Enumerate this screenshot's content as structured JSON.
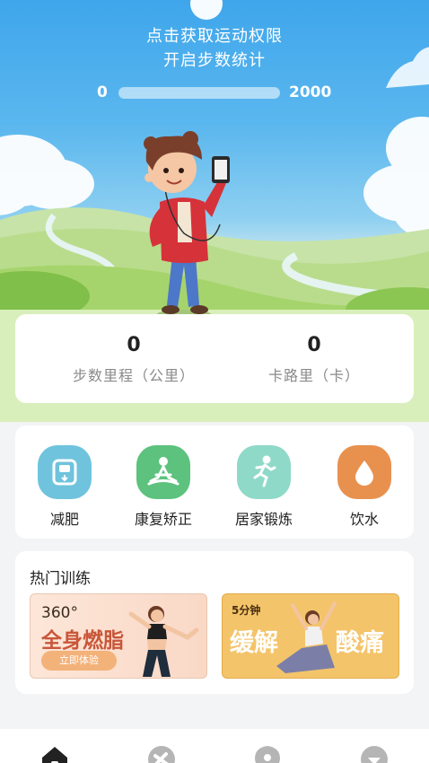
{
  "permission": {
    "line1": "点击获取运动权限",
    "line2": "开启步数统计"
  },
  "step_progress": {
    "min": "0",
    "max": "2000",
    "fraction": 0.0
  },
  "stats": [
    {
      "value": "0",
      "label": "步数里程（公里）"
    },
    {
      "value": "0",
      "label": "卡路里（卡）"
    }
  ],
  "categories": [
    {
      "label": "减肥",
      "icon": "scale-icon",
      "color": "#6fc3dd"
    },
    {
      "label": "康复矫正",
      "icon": "meditation-icon",
      "color": "#5cc27e"
    },
    {
      "label": "居家锻炼",
      "icon": "running-icon",
      "color": "#8fd9c8"
    },
    {
      "label": "饮水",
      "icon": "water-drop-icon",
      "color": "#e8914f"
    }
  ],
  "training": {
    "title": "热门训练",
    "banners": [
      {
        "small": "360°",
        "big": "全身燃脂",
        "button": "立即体验"
      },
      {
        "small": "5分钟",
        "big1": "缓解",
        "big2": "酸痛"
      }
    ]
  },
  "bottom_nav": [
    {
      "icon": "home-icon",
      "active": true
    },
    {
      "icon": "dumbbell-icon",
      "active": false
    },
    {
      "icon": "location-icon",
      "active": false
    },
    {
      "icon": "profile-icon",
      "active": false
    }
  ],
  "colors": {
    "sky": "#3fa6ec",
    "accent_orange": "#c9563a",
    "nav_inactive": "#b5b5b5",
    "nav_active": "#222222"
  }
}
